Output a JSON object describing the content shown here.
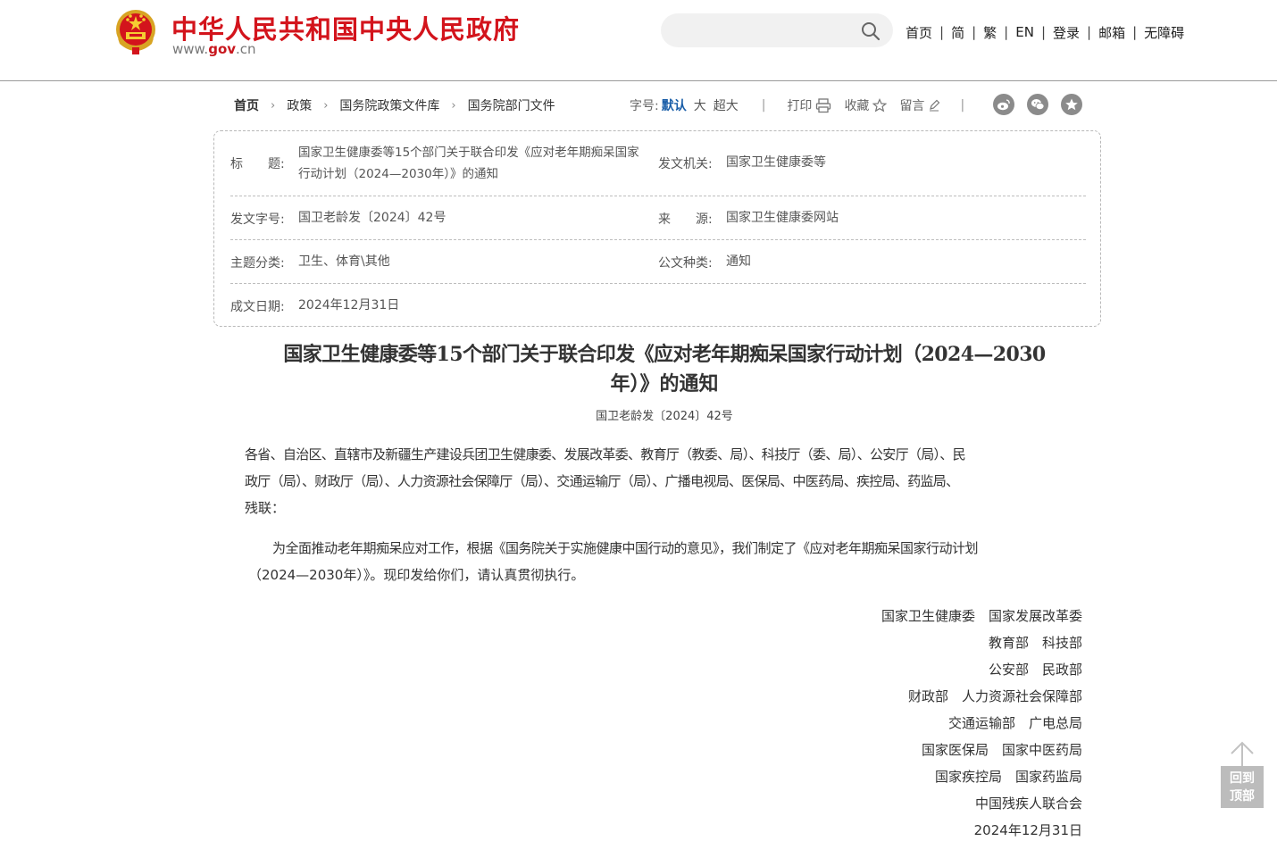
{
  "header": {
    "site_title": "中华人民共和国中央人民政府",
    "url_prefix": "www.",
    "url_domain": "gov",
    "url_suffix": ".cn",
    "search_placeholder": "",
    "nav": [
      "首页",
      "简",
      "繁",
      "EN",
      "登录",
      "邮箱",
      "无障碍"
    ],
    "nav_separator": "|"
  },
  "breadcrumb": {
    "items": [
      "首页",
      "政策",
      "国务院政策文件库",
      "国务院部门文件"
    ],
    "arrow": "›"
  },
  "toolbar": {
    "font_size_label": "字号:",
    "font_default": "默认",
    "font_large": "大",
    "font_xlarge": "超大",
    "divider": "|",
    "print": "打印",
    "favorite": "收藏",
    "comment": "留言"
  },
  "metadata": {
    "title_label": "标　　题:",
    "title_line1": "国家卫生健康委等15个部门关于联合印发《应对老年期痴呆国家",
    "title_line2": "行动计划（2024—2030年）》的通知",
    "issuer_label": "发文机关:",
    "issuer_value": "国家卫生健康委等",
    "doc_no_label": "发文字号:",
    "doc_no_value": "国卫老龄发〔2024〕42号",
    "source_label": "来　　源:",
    "source_value": "国家卫生健康委网站",
    "topic_label": "主题分类:",
    "topic_value": "卫生、体育\\其他",
    "doc_type_label": "公文种类:",
    "doc_type_value": "通知",
    "date_label": "成文日期:",
    "date_value": "2024年12月31日"
  },
  "article": {
    "title_line1": "国家卫生健康委等15个部门关于联合印发《应对老年期痴呆国家行动计划（2024—2030",
    "title_line2": "年）》的通知",
    "doc_number": "国卫老龄发〔2024〕42号",
    "recipients_line1": "各省、自治区、直辖市及新疆生产建设兵团卫生健康委、发展改革委、教育厅（教委、局）、科技厅（委、局）、公安厅（局）、民",
    "recipients_line2": "政厅（局）、财政厅（局）、人力资源社会保障厅（局）、交通运输厅（局）、广播电视局、医保局、中医药局、疾控局、药监局、",
    "recipients_line3": "残联：",
    "body_line1": "为全面推动老年期痴呆应对工作，根据《国务院关于实施健康中国行动的意见》，我们制定了《应对老年期痴呆国家行动计划",
    "body_line2": "（2024—2030年）》。现印发给你们，请认真贯彻执行。",
    "signatories": [
      "国家卫生健康委　国家发展改革委",
      "教育部　科技部",
      "公安部　民政部",
      "财政部　人力资源社会保障部",
      "交通运输部　广电总局",
      "国家医保局　国家中医药局",
      "国家疾控局　国家药监局",
      "中国残疾人联合会",
      "2024年12月31日"
    ]
  },
  "back_to_top": {
    "line1": "回到",
    "line2": "顶部"
  },
  "colors": {
    "brand_red": "#d3141c",
    "link_blue": "#1a5ea8",
    "icon_gray": "#8b8b8b"
  }
}
